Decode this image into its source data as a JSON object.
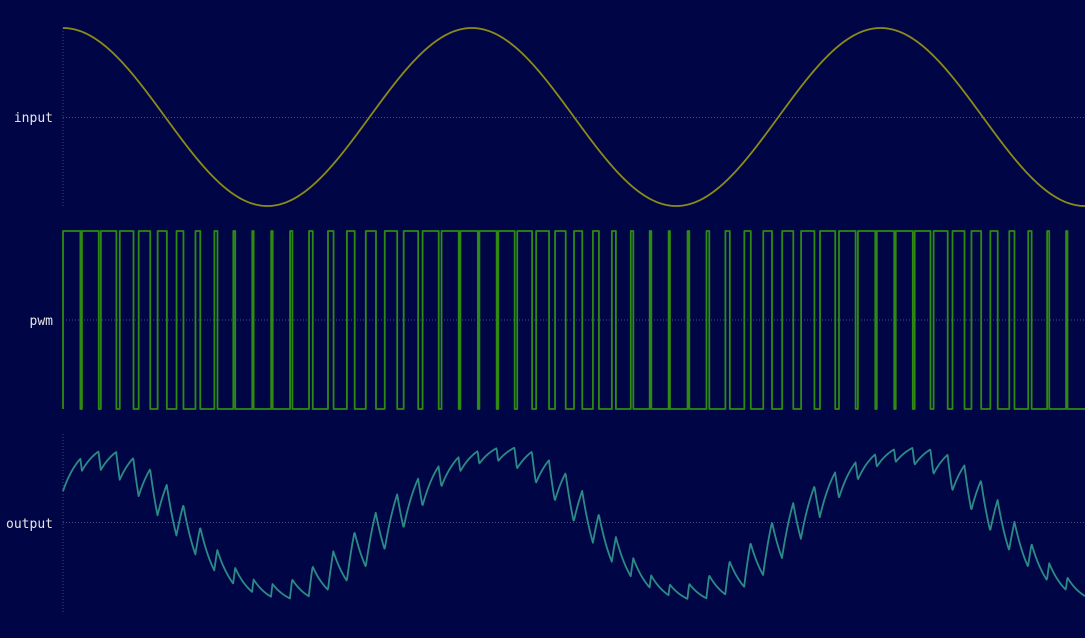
{
  "chart_data": {
    "type": "line",
    "colors": {
      "background": "#000645",
      "input": "#8c8a18",
      "pwm": "#2e8a12",
      "output": "#2c8a86",
      "midline": "#5a6a9a",
      "label": "#e6e6e6"
    },
    "grid": "dotted zero line per channel",
    "x_range": [
      0,
      2.5
    ],
    "channels": [
      {
        "name": "input",
        "label": "input",
        "kind": "sine",
        "cycles": 2.5,
        "amplitude": 1,
        "phase_start": "peak",
        "ylim": [
          -1,
          1
        ]
      },
      {
        "name": "pwm",
        "label": "pwm",
        "kind": "pwm",
        "pulses": 54,
        "levels": [
          0,
          1
        ],
        "duty_follows": "input",
        "ylim": [
          0,
          1
        ]
      },
      {
        "name": "output",
        "label": "output",
        "kind": "filtered",
        "source": "pwm",
        "ylim": [
          -1,
          1
        ]
      }
    ]
  }
}
